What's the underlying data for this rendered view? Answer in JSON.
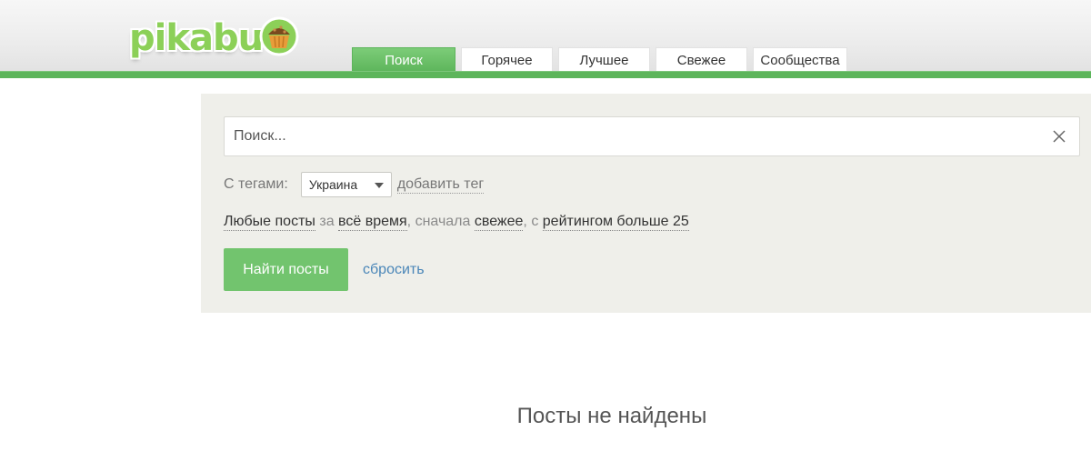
{
  "header": {
    "logo_text": "pikabu",
    "logo_icon": "cupcake-icon",
    "accent_color": "#5db55b",
    "tabs": [
      {
        "label": "Поиск",
        "active": true
      },
      {
        "label": "Горячее",
        "active": false
      },
      {
        "label": "Лучшее",
        "active": false
      },
      {
        "label": "Свежее",
        "active": false
      },
      {
        "label": "Сообщества",
        "active": false
      }
    ]
  },
  "search": {
    "placeholder": "Поиск...",
    "value": "",
    "clear_icon": "close-icon"
  },
  "tags": {
    "label": "С тегами:",
    "selected": "Украина",
    "add_tag": "добавить тег"
  },
  "filters": {
    "posts": "Любые посты",
    "for": "за",
    "period": "всё время",
    "order_prefix": ", сначала",
    "order": "свежее",
    "with": ", с",
    "rating": "рейтингом больше 25"
  },
  "actions": {
    "find": "Найти посты",
    "reset": "сбросить"
  },
  "results": {
    "empty_text": "Посты не найдены"
  }
}
